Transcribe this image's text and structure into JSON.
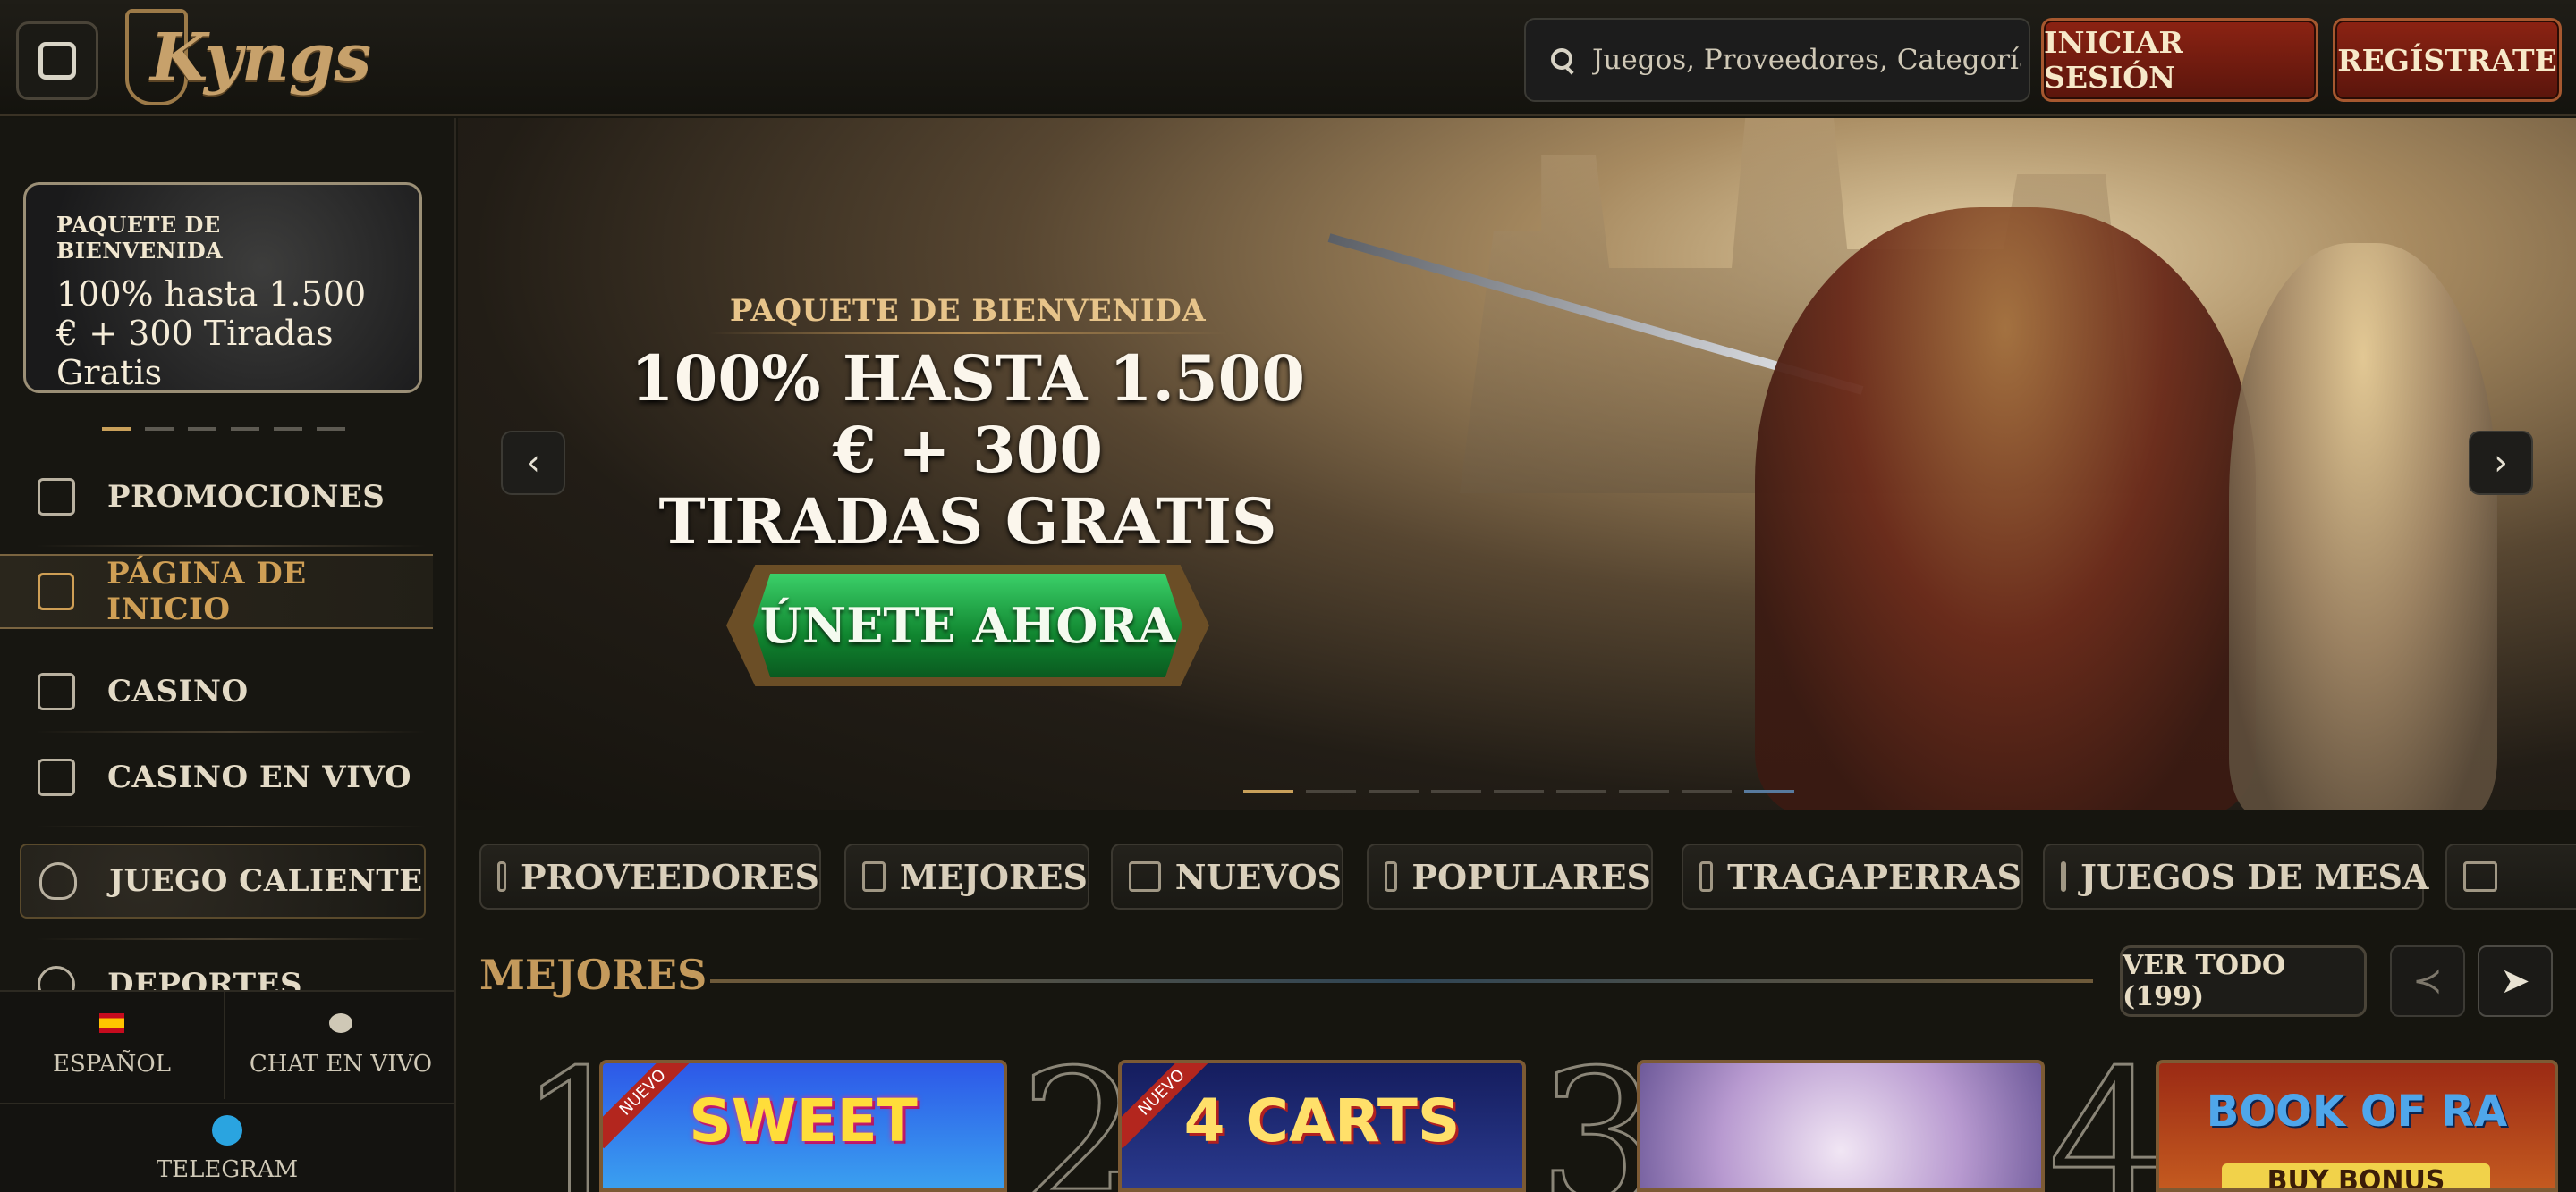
{
  "header": {
    "brand": "Kyngs",
    "search_placeholder": "Juegos, Proveedores, Categorías",
    "login_label": "INICIAR SESIÓN",
    "register_label": "REGÍSTRATE"
  },
  "sidebar": {
    "promo": {
      "kicker": "PAQUETE DE BIENVENIDA",
      "offer": "100% hasta 1.500 € + 300 Tiradas Gratis"
    },
    "items": [
      {
        "label": "PROMOCIONES",
        "icon": "gift-icon"
      },
      {
        "label": "PÁGINA DE INICIO",
        "icon": "castle-icon",
        "active": true
      },
      {
        "label": "CASINO",
        "icon": "casino-building-icon"
      },
      {
        "label": "CASINO EN VIVO",
        "icon": "cards-icon"
      },
      {
        "label": "JUEGO CALIENTE",
        "icon": "flame-icon"
      },
      {
        "label": "DEPORTES",
        "icon": "ball-icon"
      }
    ],
    "language_label": "ESPAÑOL",
    "chat_label": "CHAT EN VIVO",
    "telegram_label": "TELEGRAM"
  },
  "hero": {
    "kicker": "PAQUETE DE BIENVENIDA",
    "headline_line1": "100% HASTA 1.500 € + 300",
    "headline_line2": "TIRADAS GRATIS",
    "cta_label": "ÚNETE AHORA",
    "prev_arrow": "‹",
    "next_arrow": "›"
  },
  "categories": [
    {
      "label": "PROVEEDORES",
      "icon": "book-icon"
    },
    {
      "label": "MEJORES",
      "icon": "lightning-icon"
    },
    {
      "label": "NUEVOS",
      "icon": "chest-icon"
    },
    {
      "label": "POPULARES",
      "icon": "flame-icon"
    },
    {
      "label": "TRAGAPERRAS",
      "icon": "slot-reels-icon"
    },
    {
      "label": "JUEGOS DE MESA",
      "icon": "table-cards-icon"
    }
  ],
  "section": {
    "title": "MEJORES",
    "see_all_label": "VER TODO (199)",
    "prev": "≺",
    "next": "➤"
  },
  "games": [
    {
      "rank": "1",
      "name": "SWEET",
      "tag": "NUEVO"
    },
    {
      "rank": "2",
      "name": "4 CARTS",
      "tag": "NUEVO"
    },
    {
      "rank": "3",
      "name": ""
    },
    {
      "rank": "4",
      "name": "BOOK OF RA",
      "sub": "BUY BONUS"
    }
  ]
}
